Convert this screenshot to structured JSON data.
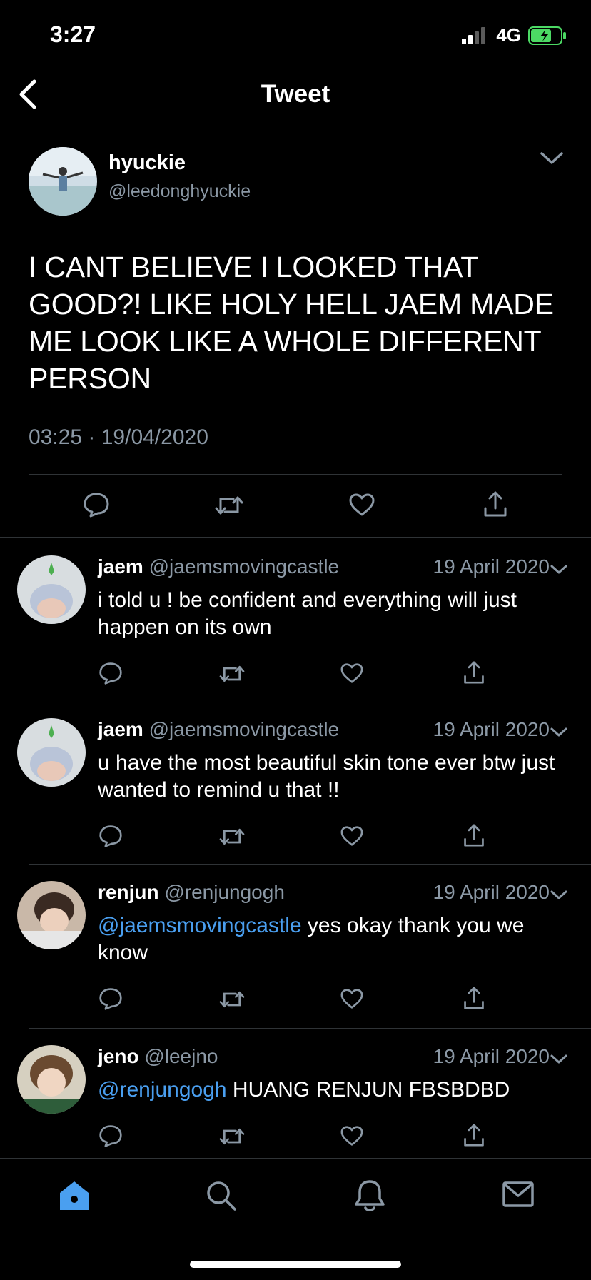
{
  "status": {
    "time": "3:27",
    "network": "4G"
  },
  "header": {
    "title": "Tweet"
  },
  "main_tweet": {
    "name": "hyuckie",
    "handle": "@leedonghyuckie",
    "text": "I CANT BELIEVE I LOOKED THAT GOOD?! LIKE HOLY HELL JAEM MADE ME LOOK LIKE A WHOLE DIFFERENT PERSON",
    "timestamp": "03:25 · 19/04/2020"
  },
  "replies": [
    {
      "name": "jaem",
      "handle": "@jaemsmovingcastle",
      "date": "19 April 2020",
      "mention": "",
      "text": "i told u ! be confident and everything will just happen on its own"
    },
    {
      "name": "jaem",
      "handle": "@jaemsmovingcastle",
      "date": "19 April 2020",
      "mention": "",
      "text": "u have the most beautiful skin tone ever btw just wanted to remind u that !!"
    },
    {
      "name": "renjun",
      "handle": "@renjungogh",
      "date": "19 April 2020",
      "mention": "@jaemsmovingcastle",
      "text": " yes okay thank you we know"
    },
    {
      "name": "jeno",
      "handle": "@leejno",
      "date": "19 April 2020",
      "mention": "@renjungogh",
      "text": " HUANG RENJUN FBSBDBD"
    }
  ],
  "tabs": [
    {
      "icon": "home-icon",
      "active": true
    },
    {
      "icon": "search-icon",
      "active": false
    },
    {
      "icon": "bell-icon",
      "active": false
    },
    {
      "icon": "mail-icon",
      "active": false
    }
  ],
  "colors": {
    "accent": "#4a9ff0",
    "muted": "#8b98a5",
    "divider": "#2f3336",
    "battery": "#4cd964"
  }
}
